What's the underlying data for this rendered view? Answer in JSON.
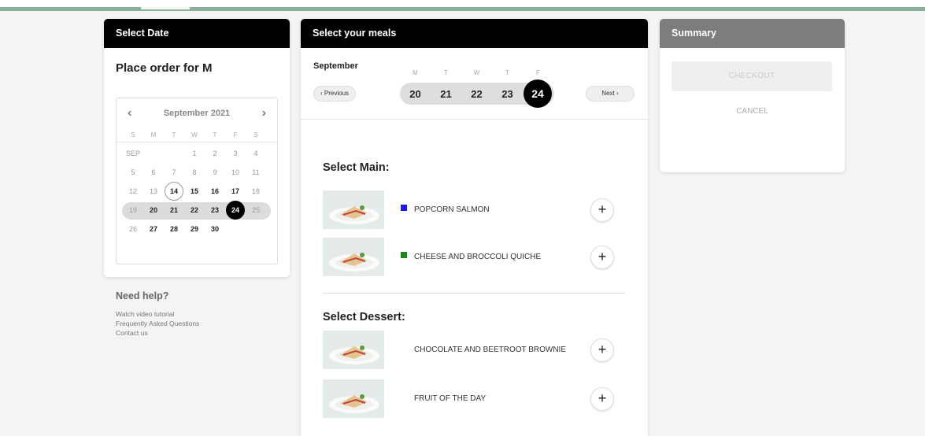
{
  "colors": {
    "accent": "#8bb09a",
    "header_black": "#000000",
    "summary_header": "#7d7d7d",
    "main_blue": "#1a1ae6",
    "main_green": "#1a8a1a"
  },
  "date_panel": {
    "header": "Select Date",
    "title": "Place order for M",
    "calendar": {
      "month_label": "September 2021",
      "prev_icon": "chevron-left-icon",
      "next_icon": "chevron-right-icon",
      "weekdays": [
        "S",
        "M",
        "T",
        "W",
        "T",
        "F",
        "S"
      ],
      "rows": [
        [
          "SEP",
          "",
          "",
          "1",
          "2",
          "3",
          "4"
        ],
        [
          "5",
          "6",
          "7",
          "8",
          "9",
          "10",
          "11"
        ],
        [
          "12",
          "13",
          "14",
          "15",
          "16",
          "17",
          "18"
        ],
        [
          "19",
          "20",
          "21",
          "22",
          "23",
          "24",
          "25"
        ],
        [
          "26",
          "27",
          "28",
          "29",
          "30",
          "",
          ""
        ]
      ],
      "today": "14",
      "selected": "24"
    }
  },
  "help": {
    "title": "Need help?",
    "links": [
      "Watch video tutorial",
      "Frequently Asked Questions",
      "Contact us"
    ]
  },
  "meals_panel": {
    "header": "Select your meals",
    "month": "September",
    "prev_label": "Previous",
    "next_label": "Next",
    "weekdays": [
      "M",
      "T",
      "W",
      "T",
      "F"
    ],
    "days": [
      "20",
      "21",
      "22",
      "23",
      "24"
    ],
    "selected_day": "24",
    "sections": [
      {
        "title": "Select Main:",
        "items": [
          {
            "name": "POPCORN SALMON",
            "marker_color": "#1a1ae6"
          },
          {
            "name": "CHEESE AND BROCCOLI QUICHE",
            "marker_color": "#1a8a1a"
          }
        ]
      },
      {
        "title": "Select Dessert:",
        "items": [
          {
            "name": "CHOCOLATE AND BEETROOT BROWNIE",
            "marker_color": ""
          },
          {
            "name": "FRUIT OF THE DAY",
            "marker_color": ""
          }
        ]
      }
    ],
    "add_symbol": "+"
  },
  "summary_panel": {
    "header": "Summary",
    "checkout_label": "CHECKOUT",
    "cancel_label": "CANCEL"
  }
}
